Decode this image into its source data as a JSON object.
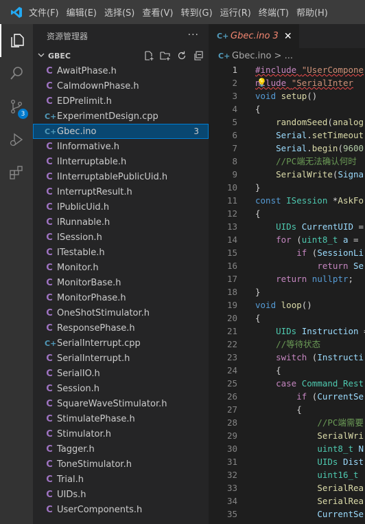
{
  "menu": [
    "文件(F)",
    "编辑(E)",
    "选择(S)",
    "查看(V)",
    "转到(G)",
    "运行(R)",
    "终端(T)",
    "帮助(H)"
  ],
  "activity": {
    "scm_badge": "3"
  },
  "explorer": {
    "title": "资源管理器",
    "more": "···",
    "folder": "GBEC",
    "files": [
      {
        "name": "AwaitPhase.h",
        "type": "h"
      },
      {
        "name": "CalmdownPhase.h",
        "type": "h"
      },
      {
        "name": "EDPrelimit.h",
        "type": "h"
      },
      {
        "name": "ExperimentDesign.cpp",
        "type": "cpp"
      },
      {
        "name": "Gbec.ino",
        "type": "cpp",
        "selected": true,
        "count": "3"
      },
      {
        "name": "IInformative.h",
        "type": "h"
      },
      {
        "name": "IInterruptable.h",
        "type": "h"
      },
      {
        "name": "IInterruptablePublicUid.h",
        "type": "h"
      },
      {
        "name": "InterruptResult.h",
        "type": "h"
      },
      {
        "name": "IPublicUid.h",
        "type": "h"
      },
      {
        "name": "IRunnable.h",
        "type": "h"
      },
      {
        "name": "ISession.h",
        "type": "h"
      },
      {
        "name": "ITestable.h",
        "type": "h"
      },
      {
        "name": "Monitor.h",
        "type": "h"
      },
      {
        "name": "MonitorBase.h",
        "type": "h"
      },
      {
        "name": "MonitorPhase.h",
        "type": "h"
      },
      {
        "name": "OneShotStimulator.h",
        "type": "h"
      },
      {
        "name": "ResponsePhase.h",
        "type": "h"
      },
      {
        "name": "SerialInterrupt.cpp",
        "type": "cpp"
      },
      {
        "name": "SerialInterrupt.h",
        "type": "h"
      },
      {
        "name": "SerialIO.h",
        "type": "h"
      },
      {
        "name": "Session.h",
        "type": "h"
      },
      {
        "name": "SquareWaveStimulator.h",
        "type": "h"
      },
      {
        "name": "StimulatePhase.h",
        "type": "h"
      },
      {
        "name": "Stimulator.h",
        "type": "h"
      },
      {
        "name": "Tagger.h",
        "type": "h"
      },
      {
        "name": "ToneStimulator.h",
        "type": "h"
      },
      {
        "name": "Trial.h",
        "type": "h"
      },
      {
        "name": "UIDs.h",
        "type": "h"
      },
      {
        "name": "UserComponents.h",
        "type": "h"
      }
    ]
  },
  "editor": {
    "tab": {
      "label": "Gbec.ino 3",
      "close": "✕"
    },
    "breadcrumb": "Gbec.ino > ...",
    "lines": [
      {
        "n": "1",
        "tokens": [
          [
            "ctl",
            "#include "
          ],
          [
            "str",
            "\"UserCompone"
          ]
        ],
        "squig": true
      },
      {
        "n": "2",
        "tokens": [
          [
            "ctl",
            "nclude "
          ],
          [
            "str",
            "\"SerialInter"
          ]
        ],
        "squig": true
      },
      {
        "n": "3",
        "tokens": [
          [
            "kw",
            "void "
          ],
          [
            "fn",
            "setup"
          ],
          [
            "pl",
            "()"
          ]
        ]
      },
      {
        "n": "4",
        "tokens": [
          [
            "pl",
            "{"
          ]
        ]
      },
      {
        "n": "5",
        "tokens": [
          [
            "pl",
            "    "
          ],
          [
            "fn",
            "randomSeed"
          ],
          [
            "pl",
            "("
          ],
          [
            "fn",
            "analog"
          ]
        ]
      },
      {
        "n": "6",
        "tokens": [
          [
            "pl",
            "    "
          ],
          [
            "var",
            "Serial"
          ],
          [
            "pl",
            "."
          ],
          [
            "fn",
            "setTimeout"
          ]
        ]
      },
      {
        "n": "7",
        "tokens": [
          [
            "pl",
            "    "
          ],
          [
            "var",
            "Serial"
          ],
          [
            "pl",
            "."
          ],
          [
            "fn",
            "begin"
          ],
          [
            "pl",
            "("
          ],
          [
            "num",
            "9600"
          ]
        ]
      },
      {
        "n": "8",
        "tokens": [
          [
            "pl",
            "    "
          ],
          [
            "cm",
            "//PC端无法确认何时"
          ]
        ]
      },
      {
        "n": "9",
        "tokens": [
          [
            "pl",
            "    "
          ],
          [
            "fn",
            "SerialWrite"
          ],
          [
            "pl",
            "("
          ],
          [
            "var",
            "Signa"
          ]
        ]
      },
      {
        "n": "10",
        "tokens": [
          [
            "pl",
            "}"
          ]
        ]
      },
      {
        "n": "11",
        "tokens": [
          [
            "kw",
            "const "
          ],
          [
            "ty",
            "ISession "
          ],
          [
            "pl",
            "*"
          ],
          [
            "fn",
            "AskFo"
          ]
        ]
      },
      {
        "n": "12",
        "tokens": [
          [
            "pl",
            "{"
          ]
        ]
      },
      {
        "n": "13",
        "tokens": [
          [
            "pl",
            "    "
          ],
          [
            "ty",
            "UIDs "
          ],
          [
            "var",
            "CurrentUID"
          ],
          [
            "pl",
            " ="
          ]
        ]
      },
      {
        "n": "14",
        "tokens": [
          [
            "pl",
            "    "
          ],
          [
            "ctl",
            "for "
          ],
          [
            "pl",
            "("
          ],
          [
            "ty",
            "uint8_t "
          ],
          [
            "var",
            "a"
          ],
          [
            "pl",
            " ="
          ]
        ]
      },
      {
        "n": "15",
        "tokens": [
          [
            "pl",
            "        "
          ],
          [
            "ctl",
            "if "
          ],
          [
            "pl",
            "("
          ],
          [
            "var",
            "SessionLi"
          ]
        ]
      },
      {
        "n": "16",
        "tokens": [
          [
            "pl",
            "            "
          ],
          [
            "ctl",
            "return "
          ],
          [
            "var",
            "Se"
          ]
        ]
      },
      {
        "n": "17",
        "tokens": [
          [
            "pl",
            "    "
          ],
          [
            "ctl",
            "return "
          ],
          [
            "kw",
            "nullptr"
          ],
          [
            "pl",
            ";"
          ]
        ]
      },
      {
        "n": "18",
        "tokens": [
          [
            "pl",
            "}"
          ]
        ]
      },
      {
        "n": "19",
        "tokens": [
          [
            "kw",
            "void "
          ],
          [
            "fn",
            "loop"
          ],
          [
            "pl",
            "()"
          ]
        ]
      },
      {
        "n": "20",
        "tokens": [
          [
            "pl",
            "{"
          ]
        ]
      },
      {
        "n": "21",
        "tokens": [
          [
            "pl",
            "    "
          ],
          [
            "ty",
            "UIDs "
          ],
          [
            "var",
            "Instruction"
          ],
          [
            "pl",
            " ="
          ]
        ]
      },
      {
        "n": "22",
        "tokens": [
          [
            "pl",
            "    "
          ],
          [
            "cm",
            "//等待状态"
          ]
        ]
      },
      {
        "n": "23",
        "tokens": [
          [
            "pl",
            "    "
          ],
          [
            "ctl",
            "switch "
          ],
          [
            "pl",
            "("
          ],
          [
            "var",
            "Instructi"
          ]
        ]
      },
      {
        "n": "24",
        "tokens": [
          [
            "pl",
            "    {"
          ]
        ]
      },
      {
        "n": "25",
        "tokens": [
          [
            "pl",
            "    "
          ],
          [
            "ctl",
            "case "
          ],
          [
            "ty",
            "Command_Rest"
          ]
        ]
      },
      {
        "n": "26",
        "tokens": [
          [
            "pl",
            "        "
          ],
          [
            "ctl",
            "if "
          ],
          [
            "pl",
            "("
          ],
          [
            "var",
            "CurrentSe"
          ]
        ]
      },
      {
        "n": "27",
        "tokens": [
          [
            "pl",
            "        {"
          ]
        ]
      },
      {
        "n": "28",
        "tokens": [
          [
            "pl",
            "            "
          ],
          [
            "cm",
            "//PC端需要"
          ]
        ]
      },
      {
        "n": "29",
        "tokens": [
          [
            "pl",
            "            "
          ],
          [
            "fn",
            "SerialWri"
          ]
        ]
      },
      {
        "n": "30",
        "tokens": [
          [
            "pl",
            "            "
          ],
          [
            "ty",
            "uint8_t "
          ],
          [
            "var",
            "N"
          ]
        ]
      },
      {
        "n": "31",
        "tokens": [
          [
            "pl",
            "            "
          ],
          [
            "ty",
            "UIDs "
          ],
          [
            "var",
            "Dist"
          ]
        ]
      },
      {
        "n": "32",
        "tokens": [
          [
            "pl",
            "            "
          ],
          [
            "ty",
            "uint16_t "
          ]
        ]
      },
      {
        "n": "33",
        "tokens": [
          [
            "pl",
            "            "
          ],
          [
            "fn",
            "SerialRea"
          ]
        ]
      },
      {
        "n": "34",
        "tokens": [
          [
            "pl",
            "            "
          ],
          [
            "fn",
            "SerialRea"
          ]
        ]
      },
      {
        "n": "35",
        "tokens": [
          [
            "pl",
            "            "
          ],
          [
            "var",
            "CurrentSe"
          ]
        ]
      }
    ]
  }
}
